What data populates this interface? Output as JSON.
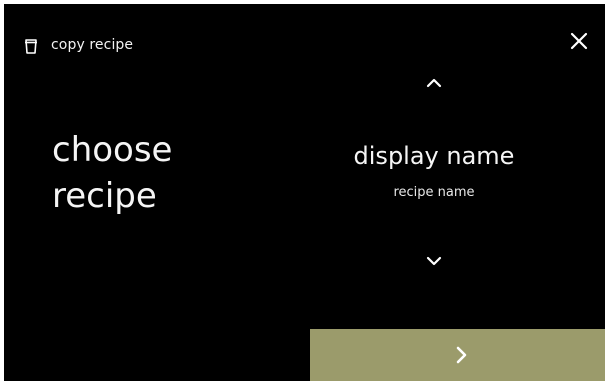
{
  "header": {
    "title": "copy recipe",
    "icon": "cup-icon",
    "close_icon": "close-icon"
  },
  "main": {
    "label": "choose\nrecipe"
  },
  "picker": {
    "up_icon": "chevron-up-icon",
    "down_icon": "chevron-down-icon",
    "selected_title": "display name",
    "selected_subtitle": "recipe name"
  },
  "footer": {
    "next_icon": "chevron-right-icon"
  },
  "colors": {
    "background": "#000000",
    "text": "#f5f5f5",
    "next_button": "#9b9b6b",
    "frame": "#ffffff"
  }
}
